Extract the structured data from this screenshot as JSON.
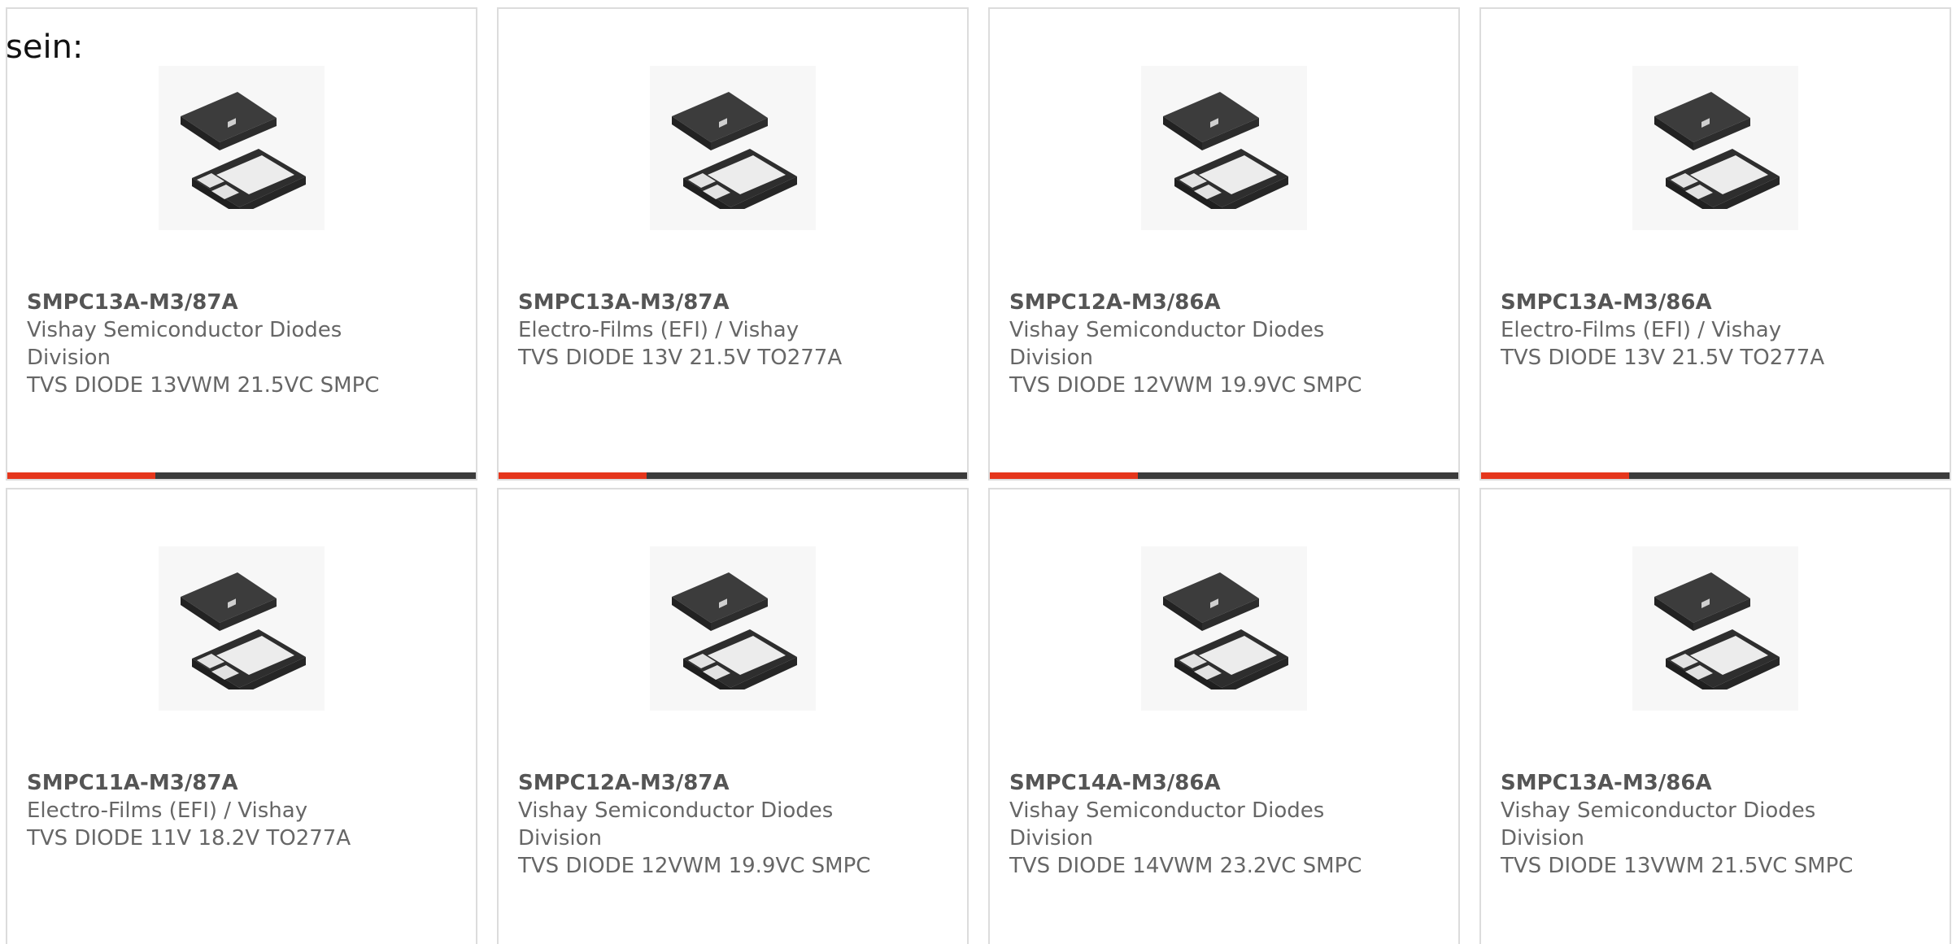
{
  "intro_text": "sein:",
  "accent_color": "#e5361c",
  "bar_color": "#3b3b3b",
  "product_image": "tvs-diode-smpc-package-image",
  "cards": [
    {
      "part": "SMPC13A-M3/87A",
      "maker": "Vishay Semiconductor Diodes Division",
      "desc": "TVS DIODE 13VWM 21.5VC SMPC",
      "show_bar": true
    },
    {
      "part": "SMPC13A-M3/87A",
      "maker": "Electro-Films (EFI) / Vishay",
      "desc": "TVS DIODE 13V 21.5V TO277A",
      "show_bar": true
    },
    {
      "part": "SMPC12A-M3/86A",
      "maker": "Vishay Semiconductor Diodes Division",
      "desc": "TVS DIODE 12VWM 19.9VC SMPC",
      "show_bar": true
    },
    {
      "part": "SMPC13A-M3/86A",
      "maker": "Electro-Films (EFI) / Vishay",
      "desc": "TVS DIODE 13V 21.5V TO277A",
      "show_bar": true
    },
    {
      "part": "SMPC11A-M3/87A",
      "maker": "Electro-Films (EFI) / Vishay",
      "desc": "TVS DIODE 11V 18.2V TO277A",
      "show_bar": false
    },
    {
      "part": "SMPC12A-M3/87A",
      "maker": "Vishay Semiconductor Diodes Division",
      "desc": "TVS DIODE 12VWM 19.9VC SMPC",
      "show_bar": false
    },
    {
      "part": "SMPC14A-M3/86A",
      "maker": "Vishay Semiconductor Diodes Division",
      "desc": "TVS DIODE 14VWM 23.2VC SMPC",
      "show_bar": false
    },
    {
      "part": "SMPC13A-M3/86A",
      "maker": "Vishay Semiconductor Diodes Division",
      "desc": "TVS DIODE 13VWM 21.5VC SMPC",
      "show_bar": false
    }
  ]
}
